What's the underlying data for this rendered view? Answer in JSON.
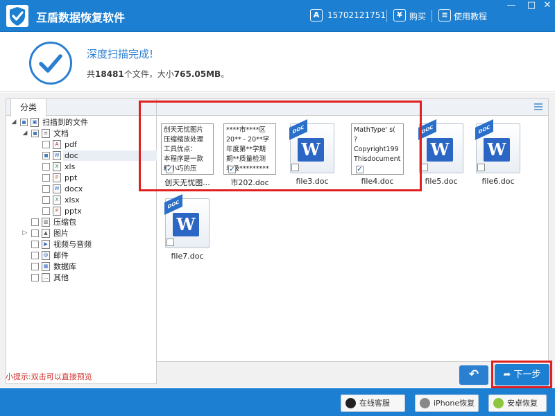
{
  "app": {
    "title": "互盾数据恢复软件",
    "phone": "15702121751",
    "buy_label": "购买",
    "tutorial_label": "使用教程",
    "buy_icon_glyph": "¥",
    "phone_icon_glyph": "A"
  },
  "window_controls": {
    "minimize": "—",
    "close": "✕"
  },
  "status": {
    "title": "深度扫描完成!",
    "summary_prefix": "共",
    "file_count": "18481",
    "summary_mid": "个文件，大小",
    "total_size": "765.05MB",
    "summary_suffix": "。"
  },
  "left_panel": {
    "tab_label": "分类",
    "tree": [
      {
        "label": "扫描到的文件",
        "icon": "computer-icon"
      },
      {
        "label": "文档",
        "icon": "document-folder-icon"
      },
      {
        "label": "pdf",
        "icon": "pdf-icon"
      },
      {
        "label": "doc",
        "icon": "doc-icon"
      },
      {
        "label": "xls",
        "icon": "xls-icon"
      },
      {
        "label": "ppt",
        "icon": "ppt-icon"
      },
      {
        "label": "docx",
        "icon": "docx-icon"
      },
      {
        "label": "xlsx",
        "icon": "xlsx-icon"
      },
      {
        "label": "pptx",
        "icon": "pptx-icon"
      },
      {
        "label": "压缩包",
        "icon": "archive-icon"
      },
      {
        "label": "图片",
        "icon": "image-icon"
      },
      {
        "label": "视频与音频",
        "icon": "video-icon"
      },
      {
        "label": "邮件",
        "icon": "mail-icon"
      },
      {
        "label": "数据库",
        "icon": "database-icon"
      },
      {
        "label": "其他",
        "icon": "other-icon"
      }
    ]
  },
  "files": [
    {
      "name": "创天无忧图...",
      "preview_lines": [
        "创天无忧图片",
        "压缩缩放处理",
        "工具优点：",
        "本程序是一款",
        "精小巧的压"
      ]
    },
    {
      "name": "市202.doc",
      "preview_lines": [
        "****市****区",
        "20** - 20**学",
        "年度第**学期",
        "期**质量检测",
        "年级*********"
      ]
    },
    {
      "name": "file3.doc"
    },
    {
      "name": "file4.doc",
      "preview_lines": [
        "MathType' s(",
        "?",
        "Copyright199",
        "Thisdocument"
      ]
    },
    {
      "name": "file5.doc"
    },
    {
      "name": "file6.doc"
    },
    {
      "name": "file7.doc"
    }
  ],
  "doc_badge": "DOC",
  "doc_letter": "W",
  "hint": "小提示:双击可以直接预览",
  "buttons": {
    "back_glyph": "↶",
    "next_label": "下一步",
    "next_arrow": "➦",
    "online_service": "在线客服",
    "iphone_recovery": "iPhone恢复",
    "android_recovery": "安卓恢复"
  },
  "colors": {
    "primary_blue": "#1d7fd1",
    "highlight_red": "#e02020",
    "hint_red": "#d0312d"
  }
}
